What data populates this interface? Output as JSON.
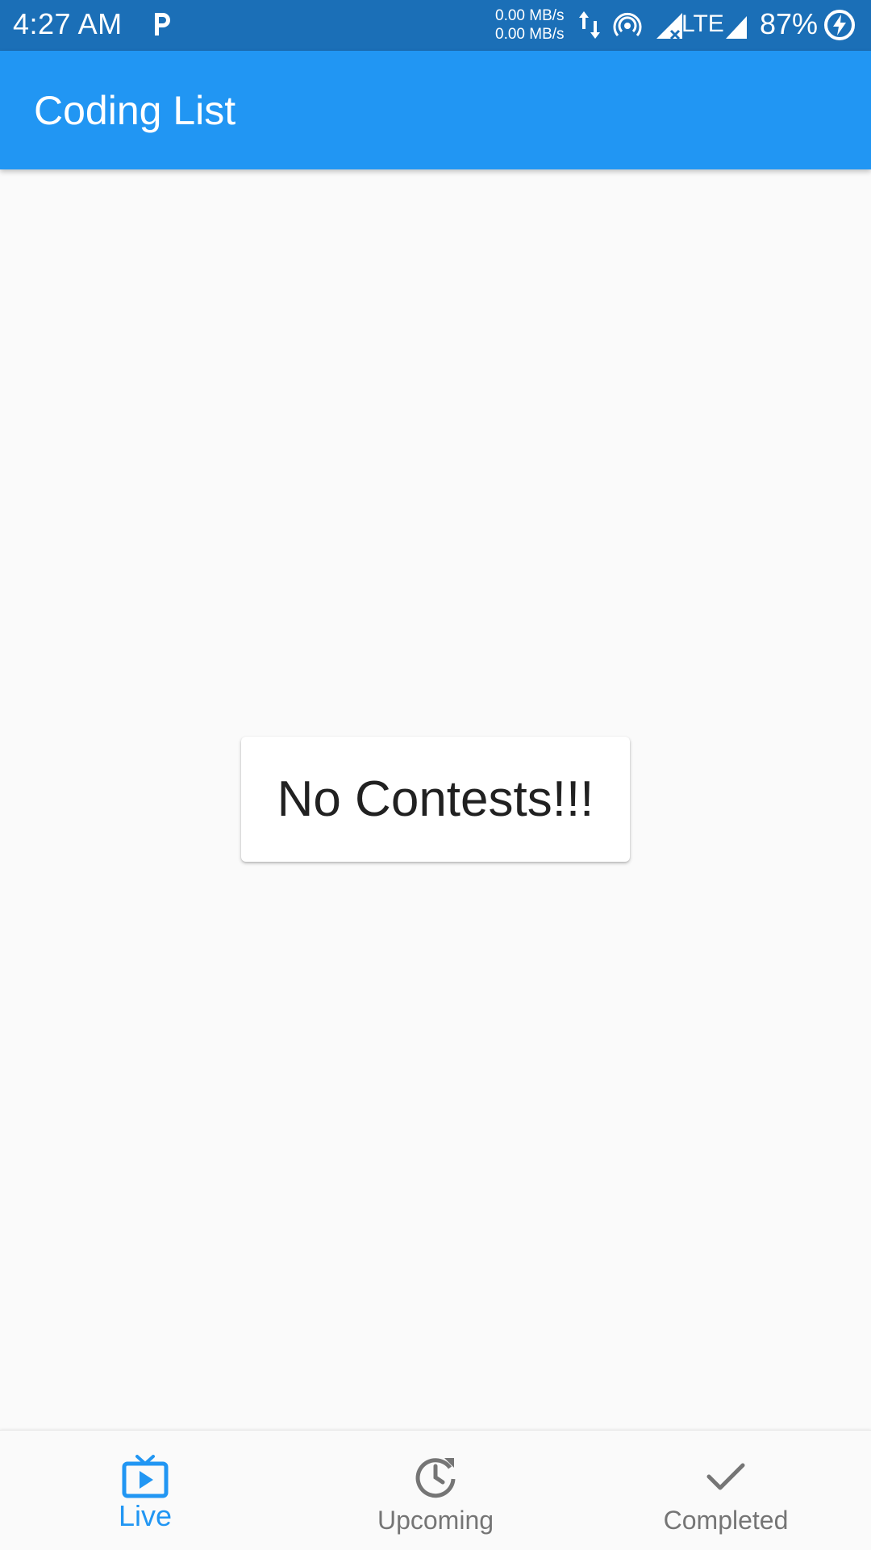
{
  "status_bar": {
    "time": "4:27 AM",
    "net_speed_up": "0.00 MB/s",
    "net_speed_down": "0.00 MB/s",
    "network_type": "LTE",
    "battery": "87%",
    "icons": [
      "p-icon",
      "data-arrows-icon",
      "hotspot-icon",
      "signal-no-data-icon",
      "signal-icon",
      "battery-charging-icon"
    ]
  },
  "app_bar": {
    "title": "Coding List"
  },
  "main": {
    "empty_message": "No Contests!!!"
  },
  "bottom_nav": {
    "selected": "Live",
    "items": [
      {
        "label": "Live",
        "icon": "live-tv-icon"
      },
      {
        "label": "Upcoming",
        "icon": "clock-refresh-icon"
      },
      {
        "label": "Completed",
        "icon": "check-icon"
      }
    ]
  },
  "colors": {
    "status_bar": "#1b6fb7",
    "app_bar": "#2196f3",
    "accent": "#2196f3",
    "inactive": "#757575",
    "background": "#fafafa"
  }
}
